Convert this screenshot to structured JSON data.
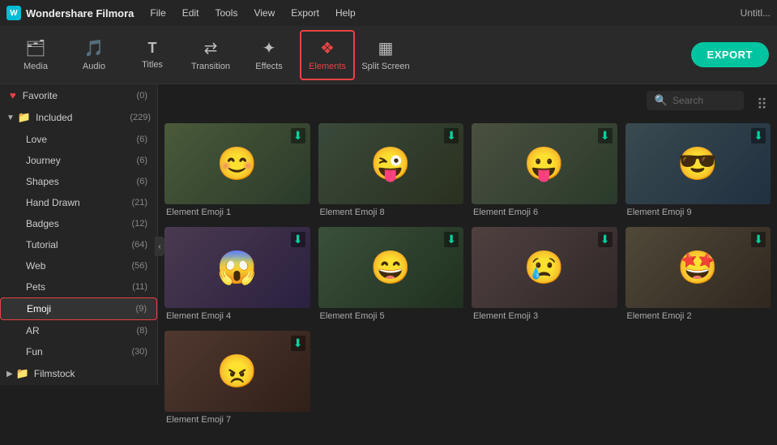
{
  "app": {
    "logo_text": "W",
    "logo_name": "Wondershare Filmora",
    "untitled": "Untitl..."
  },
  "menu": {
    "items": [
      "File",
      "Edit",
      "Tools",
      "View",
      "Export",
      "Help"
    ]
  },
  "toolbar": {
    "items": [
      {
        "id": "media",
        "label": "Media",
        "icon": "🗂"
      },
      {
        "id": "audio",
        "label": "Audio",
        "icon": "🎵"
      },
      {
        "id": "titles",
        "label": "Titles",
        "icon": "T"
      },
      {
        "id": "transition",
        "label": "Transition",
        "icon": "⇄"
      },
      {
        "id": "effects",
        "label": "Effects",
        "icon": "✦"
      },
      {
        "id": "elements",
        "label": "Elements",
        "icon": "❖",
        "active": true
      },
      {
        "id": "splitscreen",
        "label": "Split Screen",
        "icon": "▦"
      }
    ],
    "export_label": "EXPORT"
  },
  "sidebar": {
    "favorite_label": "Favorite",
    "favorite_count": "(0)",
    "included_label": "Included",
    "included_count": "(229)",
    "sub_items": [
      {
        "id": "love",
        "label": "Love",
        "count": "(6)"
      },
      {
        "id": "journey",
        "label": "Journey",
        "count": "(6)"
      },
      {
        "id": "shapes",
        "label": "Shapes",
        "count": "(6)"
      },
      {
        "id": "hand-drawn",
        "label": "Hand Drawn",
        "count": "(21)"
      },
      {
        "id": "badges",
        "label": "Badges",
        "count": "(12)"
      },
      {
        "id": "tutorial",
        "label": "Tutorial",
        "count": "(64)"
      },
      {
        "id": "web",
        "label": "Web",
        "count": "(56)"
      },
      {
        "id": "pets",
        "label": "Pets",
        "count": "(11)"
      },
      {
        "id": "emoji",
        "label": "Emoji",
        "count": "(9)",
        "selected": true
      },
      {
        "id": "ar",
        "label": "AR",
        "count": "(8)"
      },
      {
        "id": "fun",
        "label": "Fun",
        "count": "(30)"
      }
    ],
    "filmstock_label": "Filmstock"
  },
  "search": {
    "placeholder": "Search"
  },
  "grid": {
    "items": [
      {
        "id": "emoji1",
        "label": "Element Emoji 1",
        "emoji": "😊"
      },
      {
        "id": "emoji8",
        "label": "Element Emoji 8",
        "emoji": "😜"
      },
      {
        "id": "emoji6",
        "label": "Element Emoji 6",
        "emoji": "😛"
      },
      {
        "id": "emoji9",
        "label": "Element Emoji 9",
        "emoji": "😎"
      },
      {
        "id": "emoji4",
        "label": "Element Emoji 4",
        "emoji": "😱"
      },
      {
        "id": "emoji5",
        "label": "Element Emoji 5",
        "emoji": "😄"
      },
      {
        "id": "emoji3",
        "label": "Element Emoji 3",
        "emoji": "😢"
      },
      {
        "id": "emoji2",
        "label": "Element Emoji 2",
        "emoji": "🤩"
      },
      {
        "id": "emoji7",
        "label": "Element Emoji 7",
        "emoji": "😠"
      }
    ]
  }
}
